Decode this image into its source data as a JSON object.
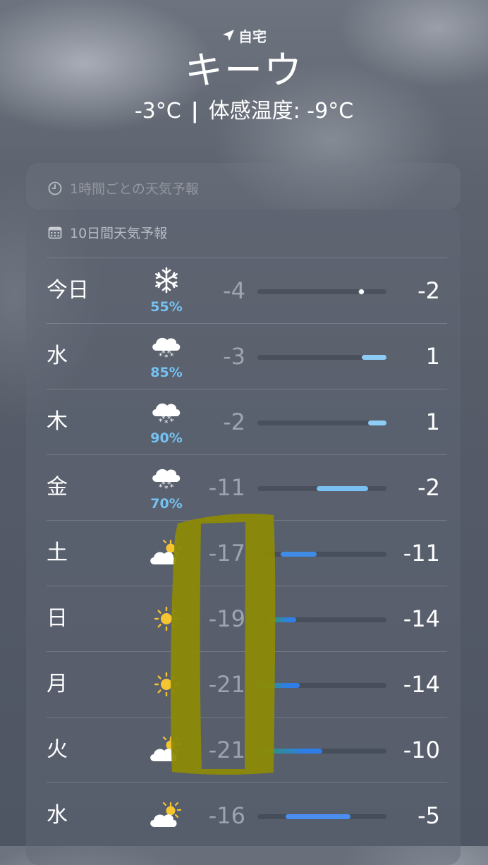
{
  "header": {
    "location_label": "自宅",
    "city": "キーウ",
    "current_temp": "-3°C",
    "separator": "|",
    "feels_like": "体感温度: -9°C"
  },
  "hourly_card": {
    "title": "1時間ごとの天気予報"
  },
  "daily_card": {
    "title": "10日間天気予報",
    "rows": [
      {
        "day": "今日",
        "icon": "snowflake-icon",
        "precip": "55%",
        "low": "-4",
        "high": "-2",
        "bar_start": 0.78,
        "bar_end": 0.82,
        "bar_color": "#b9dcf6",
        "current_dot": 0.8
      },
      {
        "day": "水",
        "icon": "cloud-snow-icon",
        "precip": "85%",
        "low": "-3",
        "high": "1",
        "bar_start": 0.81,
        "bar_end": 1.0,
        "bar_color": "#8cccf5"
      },
      {
        "day": "木",
        "icon": "cloud-snow-icon",
        "precip": "90%",
        "low": "-2",
        "high": "1",
        "bar_start": 0.86,
        "bar_end": 1.0,
        "bar_color": "#8cccf5"
      },
      {
        "day": "金",
        "icon": "cloud-snow-icon",
        "precip": "70%",
        "low": "-11",
        "high": "-2",
        "bar_start": 0.46,
        "bar_end": 0.86,
        "bar_color": "#79bff2"
      },
      {
        "day": "土",
        "icon": "partly-sunny-icon",
        "precip": "",
        "low": "-17",
        "high": "-11",
        "bar_start": 0.18,
        "bar_end": 0.46,
        "bar_color": "#3f8be6"
      },
      {
        "day": "日",
        "icon": "sun-icon",
        "precip": "",
        "low": "-19",
        "high": "-14",
        "bar_start": 0.09,
        "bar_end": 0.3,
        "bar_color": "#2f80e6"
      },
      {
        "day": "月",
        "icon": "sun-icon",
        "precip": "",
        "low": "-21",
        "high": "-14",
        "bar_start": 0.0,
        "bar_end": 0.33,
        "bar_color": "#2f7de6"
      },
      {
        "day": "火",
        "icon": "partly-sunny-icon",
        "precip": "",
        "low": "-21",
        "high": "-10",
        "bar_start": 0.0,
        "bar_end": 0.5,
        "bar_color": "#2f7de6"
      },
      {
        "day": "水",
        "icon": "partly-sunny-icon",
        "precip": "",
        "low": "-16",
        "high": "-5",
        "bar_start": 0.22,
        "bar_end": 0.72,
        "bar_color": "#4a8ff0"
      }
    ]
  },
  "colors": {
    "annotation": "#8c8a06",
    "precip_text": "#74c2f2",
    "sun": "#f5c431"
  }
}
